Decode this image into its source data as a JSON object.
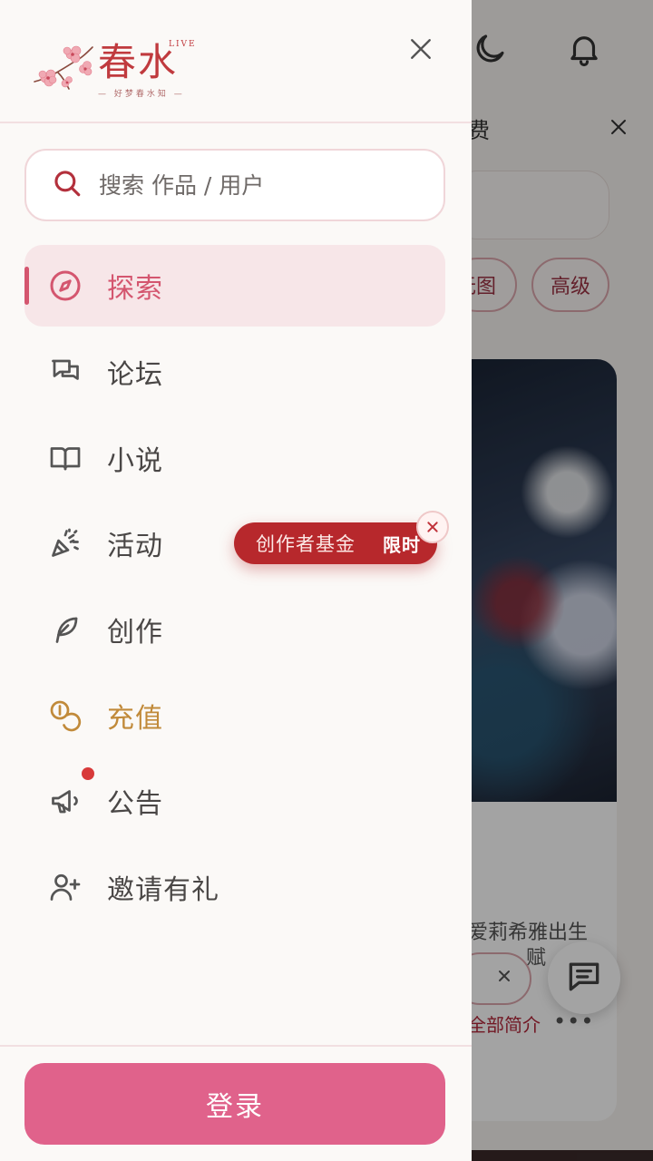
{
  "background": {
    "notice_text": "费",
    "chip_1": "无图",
    "chip_2": "高级",
    "card_desc_line1": "爱莉希雅出生",
    "card_desc_line2": "赋",
    "card_more_link": "全部简介",
    "card_more_dots": "•••"
  },
  "drawer": {
    "logo": {
      "title": "春水",
      "sup": "LIVE",
      "tagline": "— 好梦春水知 —"
    },
    "search": {
      "placeholder": "搜索 作品 / 用户"
    },
    "nav": [
      {
        "label": "探索",
        "icon": "compass-icon",
        "active": true
      },
      {
        "label": "论坛",
        "icon": "chat-bubbles-icon"
      },
      {
        "label": "小说",
        "icon": "open-book-icon"
      },
      {
        "label": "活动",
        "icon": "party-popper-icon"
      },
      {
        "label": "创作",
        "icon": "feather-icon"
      },
      {
        "label": "充值",
        "icon": "coins-icon",
        "color": "#c18a3a"
      },
      {
        "label": "公告",
        "icon": "megaphone-icon",
        "has_badge": true
      },
      {
        "label": "邀请有礼",
        "icon": "add-user-icon"
      }
    ],
    "promo": {
      "text": "创作者基金",
      "tag": "限时"
    },
    "login_label": "登录"
  },
  "colors": {
    "accent": "#d4566f",
    "login_button": "#e0628b",
    "promo": "#b7282c",
    "recharge": "#c18a3a",
    "logo": "#c03a3e"
  }
}
